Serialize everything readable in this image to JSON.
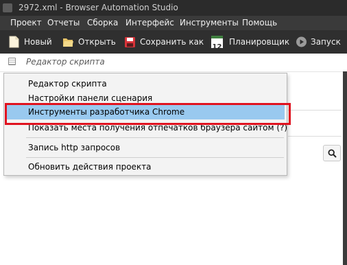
{
  "window": {
    "title": "2972.xml - Browser Automation Studio"
  },
  "menubar": {
    "items": [
      {
        "id": "project",
        "label": "Проект"
      },
      {
        "id": "reports",
        "label": "Отчеты"
      },
      {
        "id": "build",
        "label": "Сборка"
      },
      {
        "id": "interface",
        "label": "Интерфейс"
      },
      {
        "id": "tools",
        "label": "Инструменты"
      },
      {
        "id": "help",
        "label": "Помощь"
      }
    ]
  },
  "toolbar": {
    "new_label": "Новый",
    "open_label": "Открыть",
    "save_label": "Сохранить как",
    "scheduler_label": "Планировщик",
    "scheduler_icon_text": "12",
    "run_label": "Запуск"
  },
  "subbar": {
    "label": "Редактор скрипта"
  },
  "dropdown": {
    "items": [
      {
        "id": "script-editor",
        "label": "Редактор скрипта"
      },
      {
        "id": "scenario-panel-settings",
        "label": "Настройки панели сценария"
      },
      {
        "id": "chrome-devtools",
        "label": "Инструменты разработчика Chrome",
        "selected": true
      },
      {
        "id": "fingerprint-places",
        "label": "Показать места получения отпечатков браузера сайтом (?)"
      },
      {
        "id": "http-recording",
        "label": "Запись http запросов"
      },
      {
        "id": "update-actions",
        "label": "Обновить действия проекта"
      }
    ]
  },
  "colors": {
    "selection": "#99c9ef",
    "highlight_border": "#e0121f",
    "menubar_bg": "#3a3a3a",
    "toolbar_bg": "#2f2f2f"
  }
}
